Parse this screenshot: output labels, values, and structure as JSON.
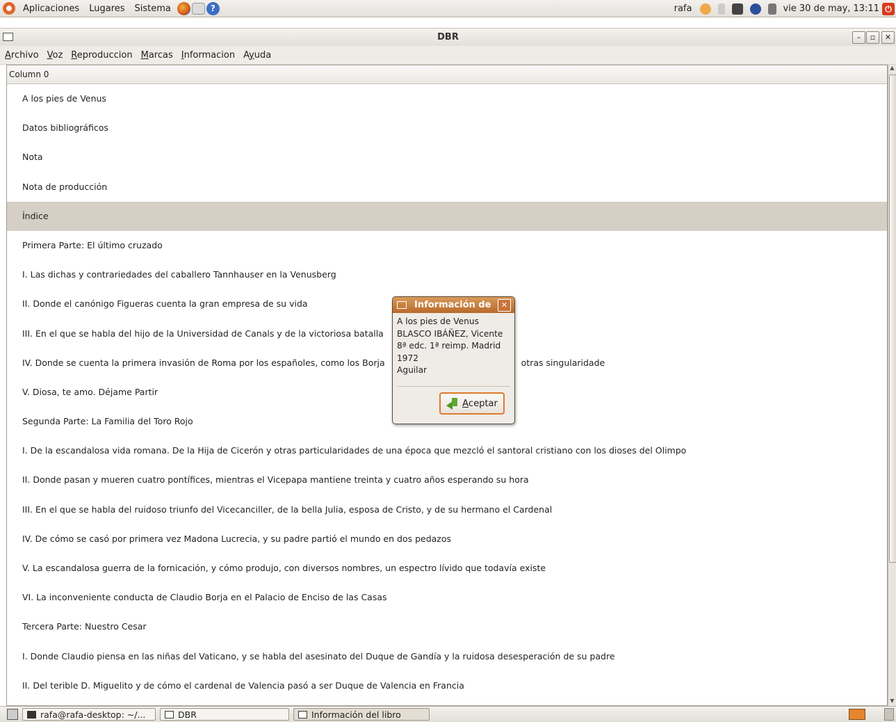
{
  "top_panel": {
    "menus": [
      "Aplicaciones",
      "Lugares",
      "Sistema"
    ],
    "user": "rafa",
    "clock": "vie 30 de may, 13:11"
  },
  "window": {
    "title": "DBR",
    "menu": [
      {
        "mnemonic": "A",
        "rest": "rchivo"
      },
      {
        "mnemonic": "V",
        "rest": "oz"
      },
      {
        "mnemonic": "R",
        "rest": "eproduccion"
      },
      {
        "mnemonic": "M",
        "rest": "arcas"
      },
      {
        "mnemonic": "I",
        "rest": "nformacion"
      },
      {
        "pre": "A",
        "mnemonic": "y",
        "rest": "uda"
      }
    ]
  },
  "list": {
    "column_header": "Column 0",
    "selected_index": 4,
    "rows": [
      "A los pies de Venus",
      "Datos bibliográficos",
      "Nota",
      "Nota de producción",
      "Índice",
      "Primera Parte: El último cruzado",
      "I. Las dichas y contrariedades del caballero Tannhauser en la Venusberg",
      "II. Donde el canónigo Figueras cuenta la gran empresa de su vida",
      "III. En el que se habla del hijo de la Universidad de Canals y de la victoriosa batalla",
      "IV. Donde se cuenta la primera invasión de Roma por los españoles, como los Borja",
      "V. Diosa, te amo. Déjame Partir",
      "Segunda Parte: La Familia del Toro Rojo",
      "I. De la escandalosa vida romana. De la Hija de Cicerón y otras particularidades de una época que mezcló el santoral cristiano con los dioses del Olimpo",
      "II. Donde pasan y mueren cuatro pontífices, mientras el Vicepapa mantiene treinta y cuatro años esperando su hora",
      "III. En el que se habla del ruidoso triunfo del Vicecanciller, de la bella Julia, esposa de Cristo, y de su hermano el Cardenal",
      "IV. De cómo se casó por primera vez Madona Lucrecia, y su padre partió el mundo en dos pedazos",
      "V. La escandalosa guerra de la fornicación, y cómo produjo, con diversos nombres, un espectro lívido que todavía existe",
      "VI. La inconveniente conducta de Claudio Borja en el Palacio de Enciso de las Casas",
      "Tercera Parte: Nuestro Cesar",
      "I. Donde Claudio piensa en las niñas del Vaticano, y se habla del asesinato del Duque de Gandía y la ruidosa desesperación de su padre",
      "II. Del terible D. Miguelito y de cómo el cardenal de Valencia pasó a ser Duque de Valencia en Francia"
    ],
    "row9_tail": "otras singularidade"
  },
  "dialog": {
    "title": "Información de",
    "lines": [
      "A los pies de Venus",
      "BLASCO IBÁÑEZ, Vicente",
      "8ª edc. 1ª reimp. Madrid",
      "1972",
      "Aguilar"
    ],
    "accept_mnemonic": "A",
    "accept_rest": "ceptar"
  },
  "taskbar": {
    "tasks": [
      "rafa@rafa-desktop: ~/...",
      "DBR",
      "Información del libro"
    ]
  }
}
